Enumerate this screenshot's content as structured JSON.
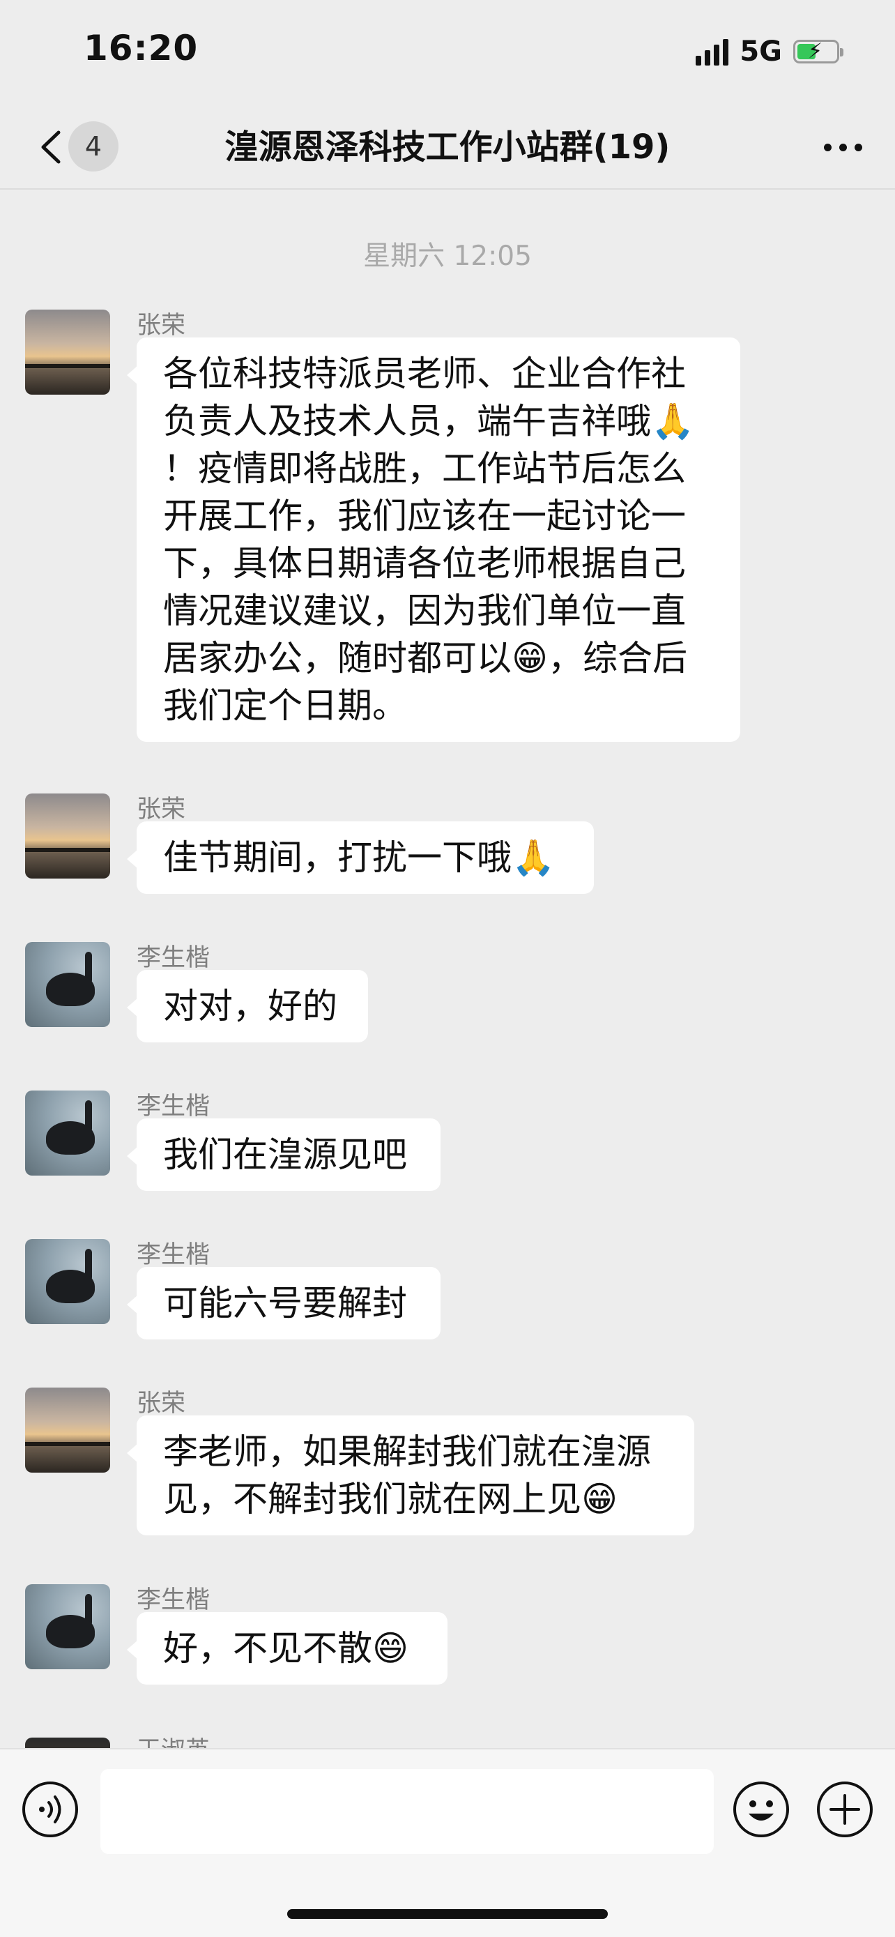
{
  "status_bar": {
    "time": "16:20",
    "network": "5G",
    "battery_charging": true
  },
  "nav": {
    "unread_count": "4",
    "title": "湟源恩泽科技工作小站群(19)"
  },
  "chat": {
    "timestamp": "星期六 12:05",
    "messages": [
      {
        "sender": "张荣",
        "avatar": "sunset",
        "lines": [
          "各位科技特派员老师、企业合作社",
          "负责人及技术人员，端午吉祥哦🙏",
          "！疫情即将战胜，工作站节后怎么",
          "开展工作，我们应该在一起讨论一",
          "下，具体日期请各位老师根据自己",
          "情况建议建议，因为我们单位一直",
          "居家办公，随时都可以😁，综合后",
          "我们定个日期。"
        ]
      },
      {
        "sender": "张荣",
        "avatar": "sunset",
        "lines": [
          "佳节期间，打扰一下哦🙏"
        ]
      },
      {
        "sender": "李生楷",
        "avatar": "swan",
        "lines": [
          "对对，好的"
        ]
      },
      {
        "sender": "李生楷",
        "avatar": "swan",
        "lines": [
          "我们在湟源见吧"
        ]
      },
      {
        "sender": "李生楷",
        "avatar": "swan",
        "lines": [
          "可能六号要解封"
        ]
      },
      {
        "sender": "张荣",
        "avatar": "sunset",
        "lines": [
          "李老师，如果解封我们就在湟源",
          "见，不解封我们就在网上见😁"
        ]
      },
      {
        "sender": "李生楷",
        "avatar": "swan",
        "lines": [
          "好，不见不散😄"
        ]
      },
      {
        "sender": "王淑英",
        "avatar": "dark",
        "lines": []
      }
    ]
  },
  "input_bar": {
    "voice_icon": "voice-icon",
    "emoji_icon": "emoji-icon",
    "plus_icon": "plus-icon",
    "text_value": ""
  },
  "colors": {
    "chat_bg": "#ededed",
    "bubble_bg": "#ffffff",
    "battery_green": "#36c759"
  }
}
